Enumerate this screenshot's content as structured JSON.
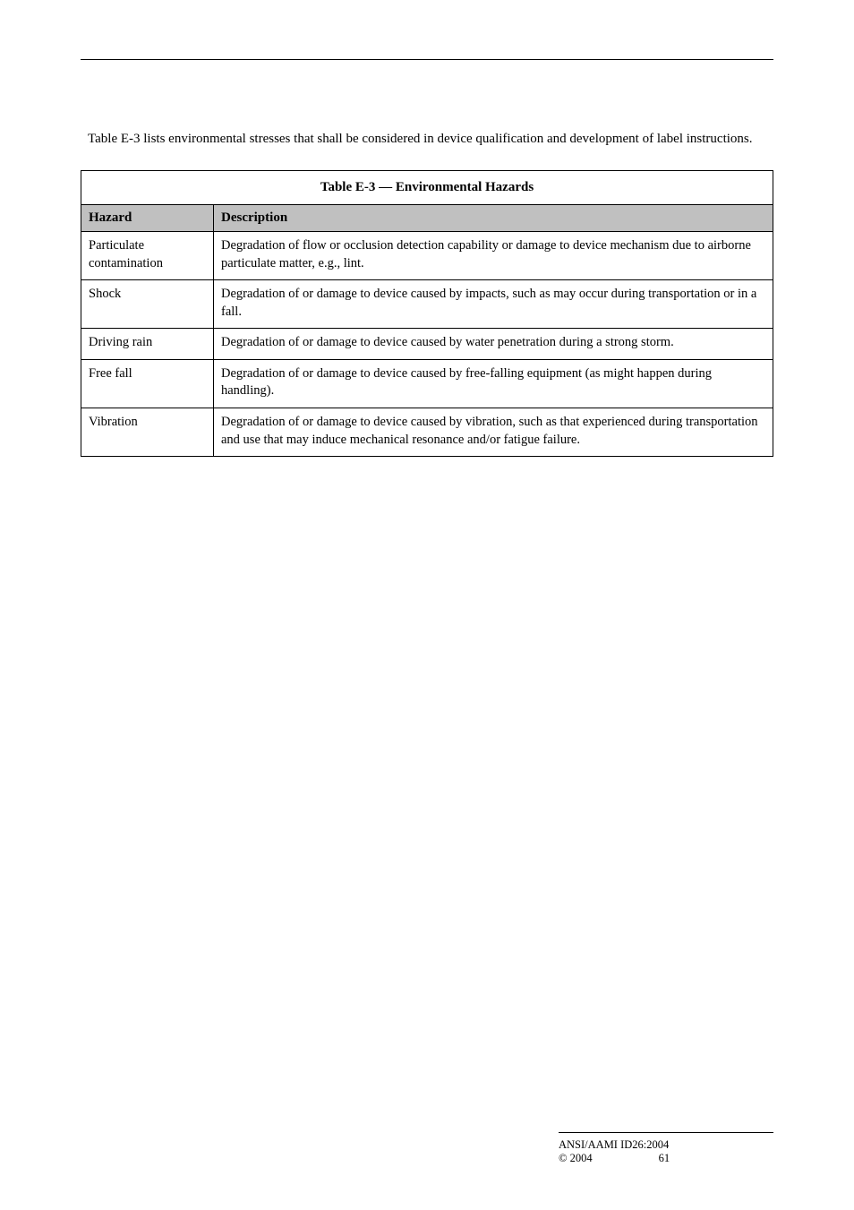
{
  "intro": "Table E-3 lists environmental stresses that shall be considered in device qualification and development of label instructions.",
  "table": {
    "title": "Table E-3 — Environmental Hazards",
    "col_a": "Hazard",
    "col_b": "Description",
    "rows": [
      {
        "a": "Particulate contamination",
        "b": "Degradation of flow or occlusion detection capability or damage to device mechanism due to airborne particulate matter, e.g., lint."
      },
      {
        "a": "Shock",
        "b": "Degradation of or damage to device caused by impacts, such as may occur during transportation or in a fall."
      },
      {
        "a": "Driving rain",
        "b": "Degradation of or damage to device caused by water penetration during a strong storm."
      },
      {
        "a": "Free fall",
        "b": "Degradation of or damage to device caused by free-falling equipment (as might happen during handling)."
      },
      {
        "a": "Vibration",
        "b": "Degradation of or damage to device caused by vibration, such as that experienced during transportation and use that may induce mechanical resonance and/or fatigue failure."
      }
    ]
  },
  "footer": {
    "line1": "ANSI/AAMI ID26:2004",
    "copyright": "© 2004",
    "page": "61"
  }
}
